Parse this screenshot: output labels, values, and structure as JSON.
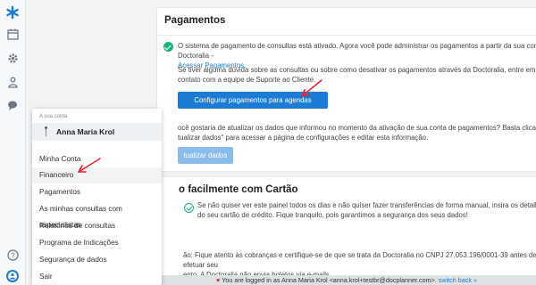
{
  "sidebar": {
    "icons": [
      "docplanner-logo-icon",
      "calendar-icon",
      "gear-icon",
      "users-icon",
      "chat-icon",
      "help-icon",
      "user-avatar-icon"
    ]
  },
  "payments": {
    "title": "Pagamentos",
    "status_text": "O sistema de pagamento de consultas está ativado. Agora você pode administrar os pagamentos a partir da sua conta Doctoralia -",
    "status_link": "Acessar Pagamentos.",
    "support_text": "Se tiver alguma dúvida sobre as consultas ou sobre como desativar os pagamentos através da Doctoralia, entre em contato com a equipe de Suporte ao Cliente.",
    "config_button": "Configurar pagamentos para agendas específicas",
    "update_text_1": "ocê gostaria de atualizar os dados que informou no momento da ativação de sua conta de pagamentos? Basta clicar em",
    "update_text_2": "tualizar dados\" para acessar a página de configurações e editar esta informação.",
    "update_button": "tualizar dados"
  },
  "card_section": {
    "title": "o facilmente com Cartão",
    "text": "Se não quiser ver este painel todos os dias e não quiser fazer transferências de forma manual, insira os detalhes do seu cartão de crédito. Fique tranquilo, pois garantimos a segurança dos seus dados!",
    "note_1": "ão: Fique atento às cobranças e certifique-se de que se trata da Doctoralia no CNPJ 27.053.196/0001-39 antes de efetuar seu",
    "note_2": "ento. A Doctoralia não envia boletos via e-mails."
  },
  "banner": {
    "text": "You are logged in as Anna Maria Krol <anna.krol+testbr@docplanner.com>.",
    "link": "switch back »"
  },
  "menu": {
    "section_label": "A sua conta",
    "user_name": "Anna Maria Krol",
    "items": [
      "Minha Conta",
      "Financeiro",
      "Pagamentos",
      "As minhas consultas com especialistas",
      "Relatórios de consultas",
      "Programa de Indicações",
      "Segurança de dados",
      "Sair"
    ]
  },
  "colors": {
    "accent": "#1c7cd5",
    "success": "#1bb47b",
    "annotation": "#e8262a"
  }
}
